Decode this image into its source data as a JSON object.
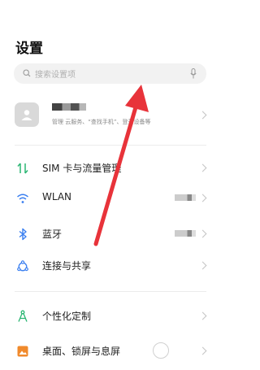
{
  "header": {
    "title": "设置"
  },
  "search": {
    "placeholder": "搜索设置项"
  },
  "account": {
    "subtitle": "管理 云服务、“查找手机”、登录设备等"
  },
  "items": [
    {
      "label": "SIM 卡与流量管理",
      "icon": "sim-data-icon"
    },
    {
      "label": "WLAN",
      "icon": "wifi-icon"
    },
    {
      "label": "蓝牙",
      "icon": "bluetooth-icon"
    },
    {
      "label": "连接与共享",
      "icon": "connection-sharing-icon"
    },
    {
      "label": "个性化定制",
      "icon": "personalization-icon"
    },
    {
      "label": "桌面、锁屏与息屏",
      "icon": "wallpaper-icon"
    }
  ],
  "colors": {
    "arrow": "#e8333a",
    "icon_blue": "#3a7ff0",
    "icon_green": "#2bb673",
    "icon_orange": "#f08a2c"
  }
}
